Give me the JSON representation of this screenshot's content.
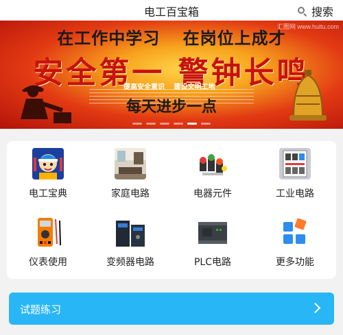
{
  "header": {
    "title": "电工百宝箱",
    "search_label": "搜索"
  },
  "banner": {
    "watermark": "汇图网 www.huitu.com",
    "line1_a": "在工作中学习",
    "line1_b": "在岗位上成才",
    "slogan": "安全第一 警钟长鸣",
    "sub_a": "提高安全意识",
    "sub_b": "建设文明工地",
    "line4": "每天进步一点",
    "active_slide": 5,
    "slide_count": 6
  },
  "grid": {
    "items": [
      {
        "label": "电工宝典",
        "icon": "electrician-mascot-icon"
      },
      {
        "label": "家庭电路",
        "icon": "home-room-icon"
      },
      {
        "label": "电器元件",
        "icon": "push-button-components-icon"
      },
      {
        "label": "工业电路",
        "icon": "industrial-panel-icon"
      },
      {
        "label": "仪表使用",
        "icon": "multimeter-icon"
      },
      {
        "label": "变频器电路",
        "icon": "inverter-icon"
      },
      {
        "label": "PLC电路",
        "icon": "plc-module-icon"
      },
      {
        "label": "更多功能",
        "icon": "more-grid-icon"
      }
    ]
  },
  "practice": {
    "label": "试题练习"
  },
  "colors": {
    "accent": "#29b6f6",
    "banner_red": "#c8120c",
    "more_orange": "#ff7b2e",
    "more_blue": "#2d8cf0"
  }
}
